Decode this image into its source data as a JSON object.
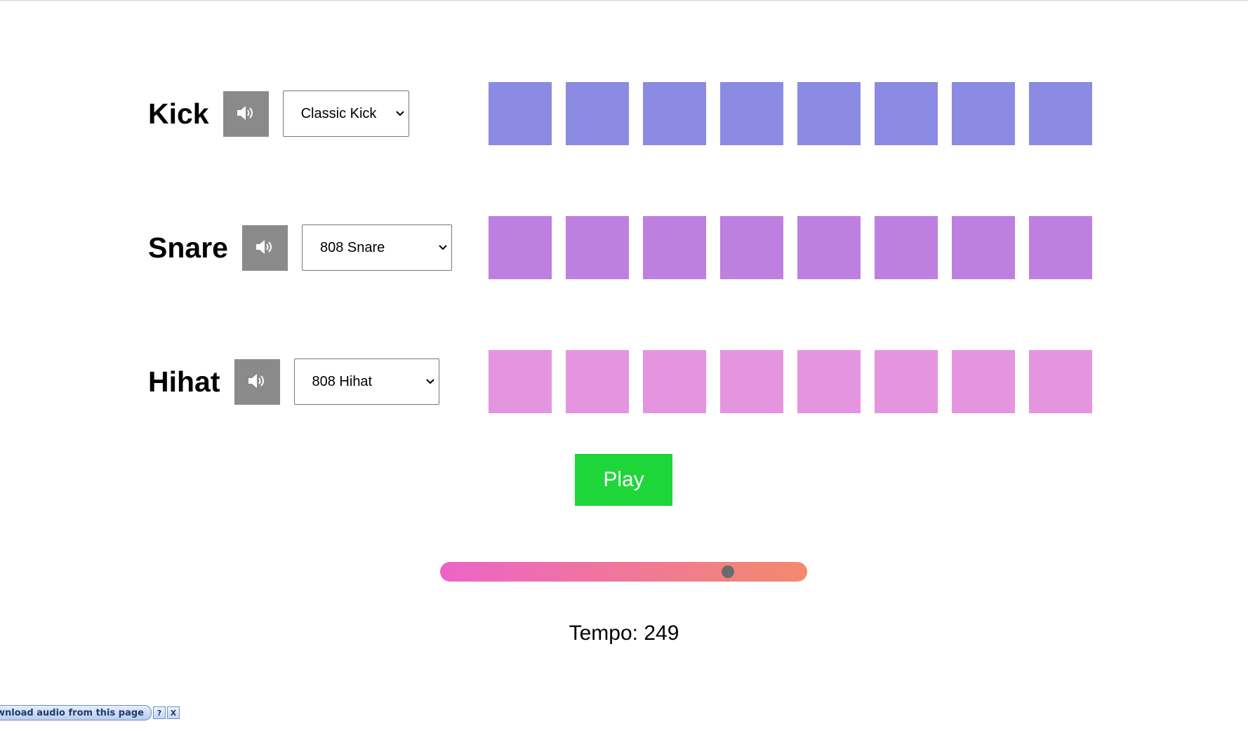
{
  "tracks": [
    {
      "name": "Kick",
      "selected_sound": "Classic Kick",
      "pad_color": "#8b8be4",
      "mute_icon": "speaker-icon",
      "steps": [
        false,
        false,
        false,
        false,
        false,
        false,
        false,
        false
      ]
    },
    {
      "name": "Snare",
      "selected_sound": "808 Snare",
      "pad_color": "#bd80e0",
      "mute_icon": "speaker-icon",
      "steps": [
        false,
        false,
        false,
        false,
        false,
        false,
        false,
        false
      ]
    },
    {
      "name": "Hihat",
      "selected_sound": "808 Hihat",
      "pad_color": "#e595df",
      "mute_icon": "speaker-icon",
      "steps": [
        false,
        false,
        false,
        false,
        false,
        false,
        false,
        false
      ]
    }
  ],
  "transport": {
    "play_label": "Play",
    "play_color": "#1ed63a"
  },
  "tempo": {
    "label": "Tempo: 249",
    "value": 249,
    "slider_fraction": 0.8,
    "gradient_start": "#ec64c8",
    "gradient_end": "#f38a6c"
  },
  "download_bar": {
    "text": "wnload audio from this page",
    "help_icon": "help-icon",
    "help_glyph": "?",
    "close_icon": "close-icon",
    "close_glyph": "X"
  }
}
